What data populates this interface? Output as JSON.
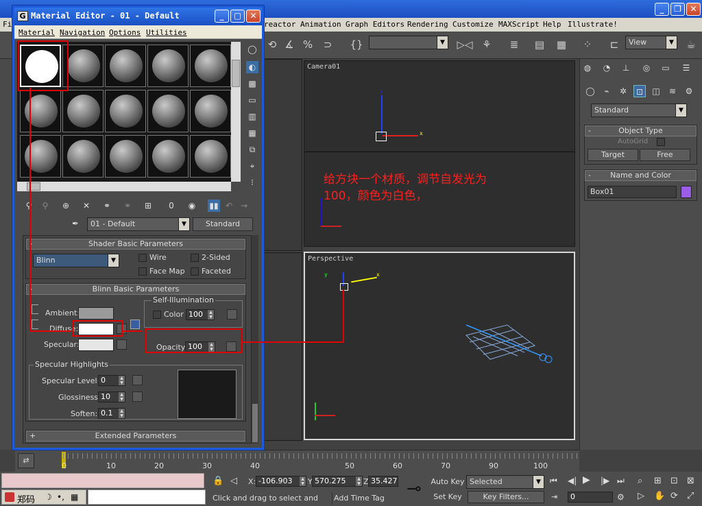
{
  "max_menu": [
    "reactor",
    "Animation",
    "Graph Editors",
    "Rendering",
    "Customize",
    "MAXScript",
    "Help",
    "Illustrate!"
  ],
  "max_menu_partial": "Fi",
  "toolbar": {
    "view_dropdown": "View",
    "selection_set": ""
  },
  "viewports": {
    "camera_label": "Camera01",
    "perspective_label": "Perspective"
  },
  "annotation": {
    "line1": "给方块一个材质，调节自发光为",
    "line2": "100，颜色为白色，"
  },
  "command_panel": {
    "category": "Standard",
    "object_type_header": "Object Type",
    "autogrid": "AutoGrid",
    "target_btn": "Target",
    "free_btn": "Free",
    "name_color_header": "Name and Color",
    "object_name": "Box01",
    "object_color": "#9b5de5"
  },
  "material_editor": {
    "title": "Material Editor - 01 - Default",
    "menu": [
      "Material",
      "Navigation",
      "Options",
      "Utilities"
    ],
    "material_name": "01 - Default",
    "material_type": "Standard",
    "mat_id": "0",
    "shader_header": "Shader Basic Parameters",
    "shader_type": "Blinn",
    "wire": "Wire",
    "two_sided": "2-Sided",
    "face_map": "Face Map",
    "faceted": "Faceted",
    "blinn_header": "Blinn Basic Parameters",
    "self_illum_group": "Self-Illumination",
    "ambient": "Ambient:",
    "diffuse": "Diffuse:",
    "specular": "Specular:",
    "color_label": "Color",
    "color_value": "100",
    "opacity_label": "Opacity:",
    "opacity_value": "100",
    "spec_highlights": "Specular Highlights",
    "spec_level_label": "Specular Level:",
    "spec_level_value": "0",
    "glossiness_label": "Glossiness:",
    "glossiness_value": "10",
    "soften_label": "Soften:",
    "soften_value": "0.1",
    "extended_header": "Extended Parameters",
    "colors": {
      "ambient": "#9a9a9a",
      "diffuse": "#ffffff",
      "specular": "#e6e6e6"
    }
  },
  "timeline": {
    "ticks": [
      "0",
      "10",
      "20",
      "30",
      "40",
      "50",
      "60",
      "70",
      "80",
      "90",
      "100"
    ],
    "frame_counter": "0"
  },
  "status": {
    "x_label": "X:",
    "x_value": "-106.903",
    "y_label": "Y:",
    "y_value": "570.275",
    "z_label": "Z:",
    "z_value": "35.427",
    "auto_key": "Auto Key",
    "selected": "Selected",
    "set_key": "Set Key",
    "key_filters": "Key Filters...",
    "frame_value": "0",
    "prompt": "Click and drag to select and move",
    "add_time_tag": "Add Time Tag",
    "ime_label": "郑码"
  }
}
